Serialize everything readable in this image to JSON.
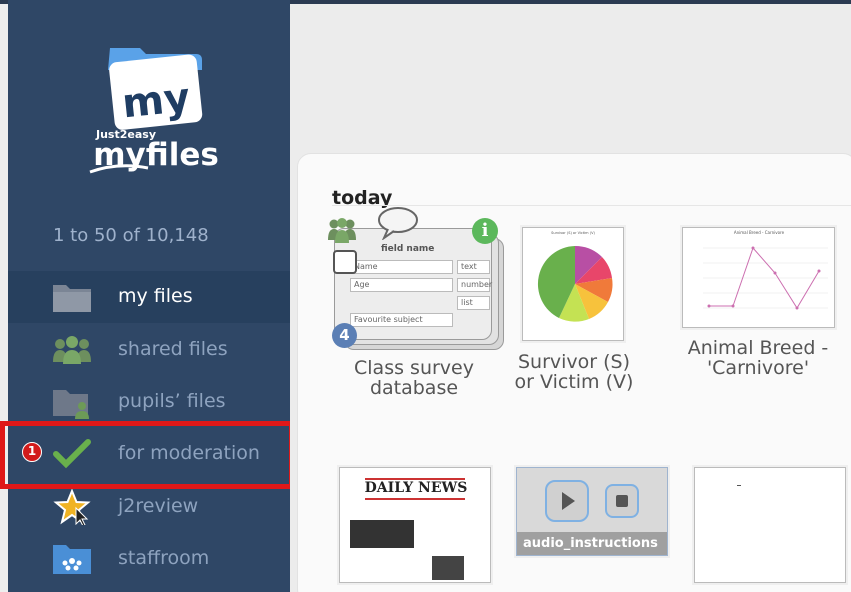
{
  "sidebar": {
    "logo": {
      "badge_text": "my",
      "brand_small": "Just2easy",
      "brand_big": "myfiles"
    },
    "count": "1 to 50 of 10,148",
    "items": [
      {
        "label": "my files",
        "icon": "folder-icon"
      },
      {
        "label": "shared files",
        "icon": "people-icon"
      },
      {
        "label": "pupils’ files",
        "icon": "pupil-folder-icon"
      },
      {
        "label": "for moderation",
        "icon": "checkmark-icon"
      },
      {
        "label": "j2review",
        "icon": "star-cursor-icon"
      },
      {
        "label": "staffroom",
        "icon": "staffroom-folder-icon"
      }
    ],
    "highlight_badge": "1"
  },
  "main": {
    "section_title": "today",
    "tiles": [
      {
        "caption": "Class survey database",
        "badge": "4",
        "info": "i",
        "db": {
          "header": "field name",
          "name": "Name",
          "age": "Age",
          "fav": "Favourite subject",
          "types": [
            "text",
            "number",
            "list"
          ]
        }
      },
      {
        "caption": "Survivor (S) or Victim (V)",
        "chart_title": "Survivor (S) or Victim (V)"
      },
      {
        "caption": "Animal Breed - 'Carnivore'",
        "chart_title": "Animal Breed - Carnivore"
      },
      {
        "caption": "",
        "newspaper_title": "DAILY NEWS"
      },
      {
        "caption": "audio_instructions"
      },
      {
        "caption": ""
      }
    ]
  },
  "colors": {
    "sidebar": "#2f4766",
    "highlight": "#e01818",
    "accent_green": "#5cb85c",
    "badge_blue": "#5b7fb5"
  }
}
